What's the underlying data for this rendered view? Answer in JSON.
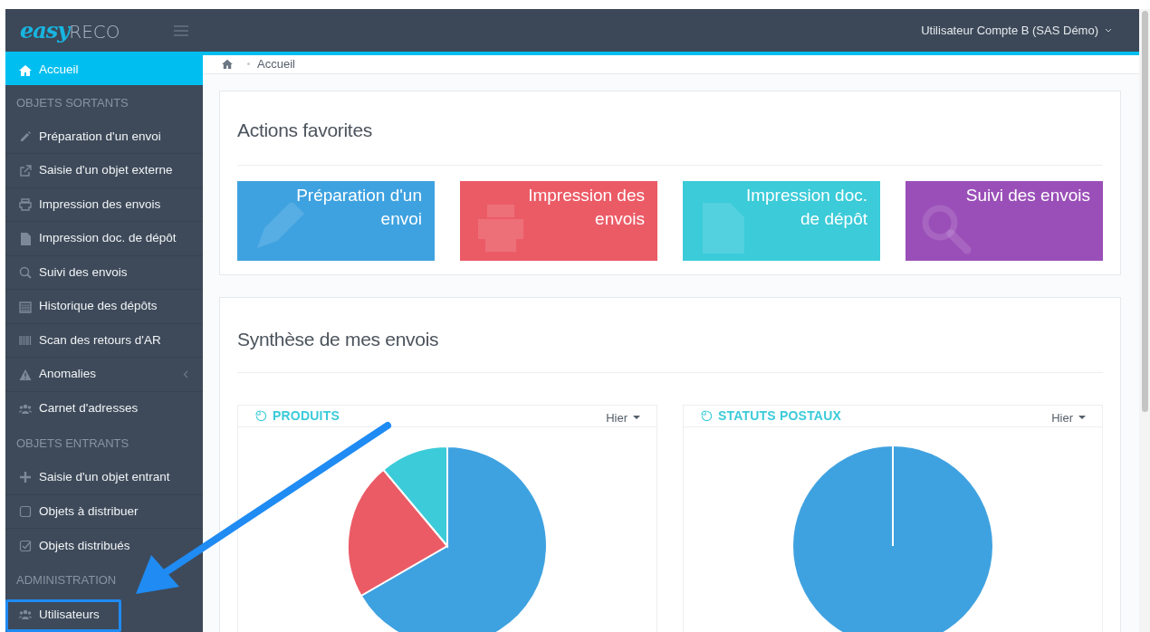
{
  "header": {
    "logo": {
      "primary": "easy",
      "secondary": "RECO"
    },
    "user_menu": "Utilisateur Compte B (SAS Démo)"
  },
  "sidebar": {
    "groups": [
      {
        "items": [
          {
            "label": "Accueil",
            "selected": true,
            "submenu": false
          }
        ]
      },
      {
        "heading": "OBJETS SORTANTS",
        "items": [
          {
            "label": "Préparation d'un envoi",
            "selected": false,
            "submenu": false
          },
          {
            "label": "Saisie d'un objet externe",
            "selected": false,
            "submenu": false
          },
          {
            "label": "Impression des envois",
            "selected": false,
            "submenu": false
          },
          {
            "label": "Impression doc. de dépôt",
            "selected": false,
            "submenu": false
          },
          {
            "label": "Suivi des envois",
            "selected": false,
            "submenu": false
          },
          {
            "label": "Historique des dépôts",
            "selected": false,
            "submenu": false
          },
          {
            "label": "Scan des retours d'AR",
            "selected": false,
            "submenu": false
          },
          {
            "label": "Anomalies",
            "selected": false,
            "submenu": true
          },
          {
            "label": "Carnet d'adresses",
            "selected": false,
            "submenu": false
          }
        ]
      },
      {
        "heading": "OBJETS ENTRANTS",
        "items": [
          {
            "label": "Saisie d'un objet entrant",
            "selected": false,
            "submenu": false
          },
          {
            "label": "Objets à distribuer",
            "selected": false,
            "submenu": false
          },
          {
            "label": "Objets distribués",
            "selected": false,
            "submenu": false
          }
        ]
      },
      {
        "heading": "ADMINISTRATION",
        "items": [
          {
            "label": "Utilisateurs",
            "selected": false,
            "submenu": false
          }
        ]
      }
    ]
  },
  "breadcrumb": [
    "Accueil"
  ],
  "favorites": {
    "title": "Actions favorites",
    "tiles": [
      {
        "label": "Préparation d'un envoi",
        "color": "#3fa2e0"
      },
      {
        "label": "Impression des envois",
        "color": "#eb5b66"
      },
      {
        "label": "Impression doc. de dépôt",
        "color": "#3bcbd9"
      },
      {
        "label": "Suivi des envois",
        "color": "#9a4fb8"
      }
    ]
  },
  "summary": {
    "title": "Synthèse de mes envois",
    "panels": [
      {
        "title": "PRODUITS",
        "period": "Hier"
      },
      {
        "title": "STATUTS POSTAUX",
        "period": "Hier"
      }
    ]
  }
}
